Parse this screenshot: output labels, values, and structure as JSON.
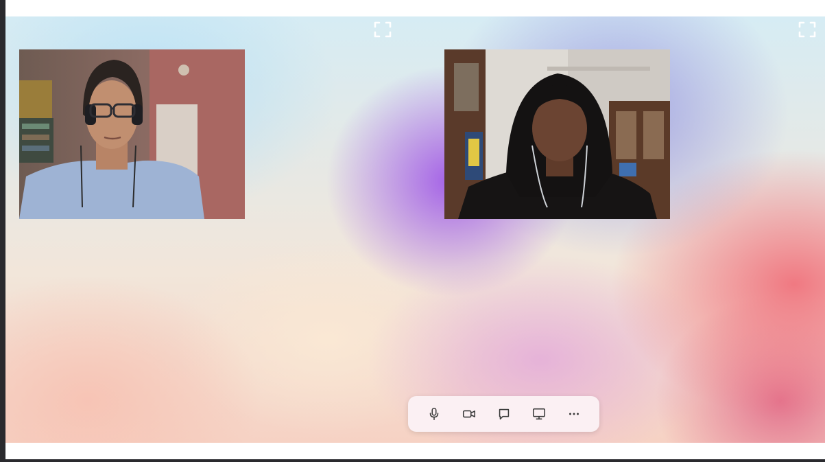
{
  "app": {
    "title": ""
  },
  "participants": [
    {
      "name": "",
      "video": "participant-1-video"
    },
    {
      "name": "",
      "video": "participant-2-video"
    }
  ],
  "controls": [
    {
      "id": "mic",
      "icon": "microphone-icon"
    },
    {
      "id": "camera",
      "icon": "video-camera-icon"
    },
    {
      "id": "chat",
      "icon": "chat-bubble-icon"
    },
    {
      "id": "share",
      "icon": "screen-share-icon"
    },
    {
      "id": "more",
      "icon": "more-options-icon",
      "glyph": "···"
    }
  ],
  "colors": {
    "control_bar": "#fbf0f3",
    "icon": "#3a3a3a",
    "expand_icon": "#ffffff"
  }
}
